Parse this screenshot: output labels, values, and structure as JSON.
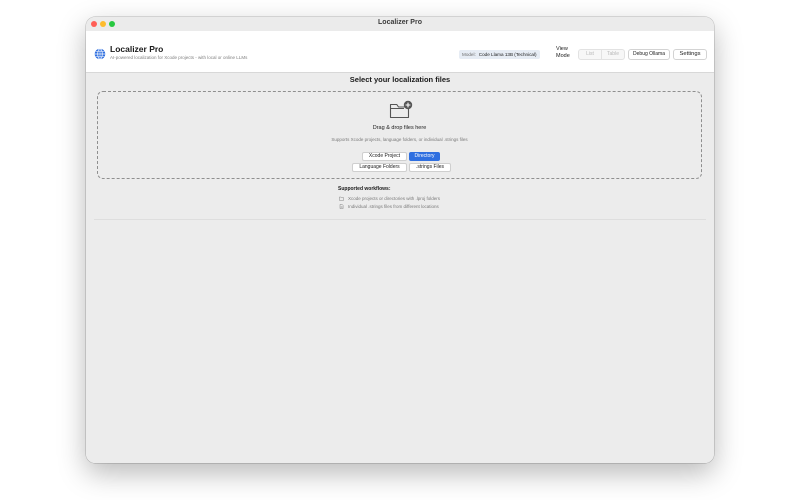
{
  "window": {
    "title": "Localizer Pro"
  },
  "header": {
    "app_name": "Localizer Pro",
    "subtitle": "AI-powered localization for Xcode projects - with local or online LLMs",
    "model_label": "Model:",
    "model_value": "Code Llama 13B (Technical)",
    "view_mode_label": "View Mode",
    "view_mode_options": [
      "List",
      "Table"
    ],
    "debug_button": "Debug Ollama",
    "settings_button": "Settings"
  },
  "main": {
    "heading": "Select your localization files",
    "dropzone": {
      "title": "Drag & drop files here",
      "subtitle": "Supports Xcode projects, language folders, or individual .strings files",
      "source_buttons": [
        "Xcode Project",
        "Directory",
        "Language Folders",
        ".strings Files"
      ],
      "selected_source": "Directory"
    },
    "workflows": {
      "title": "Supported workflows:",
      "items": [
        {
          "icon": "folder-icon",
          "text": "Xcode projects or directories with .lproj folders"
        },
        {
          "icon": "document-icon",
          "text": "Individual .strings files from different locations"
        }
      ]
    }
  },
  "colors": {
    "accent": "#2f6fe0",
    "window_background": "#ececec",
    "toolbar_background": "#ffffff"
  }
}
